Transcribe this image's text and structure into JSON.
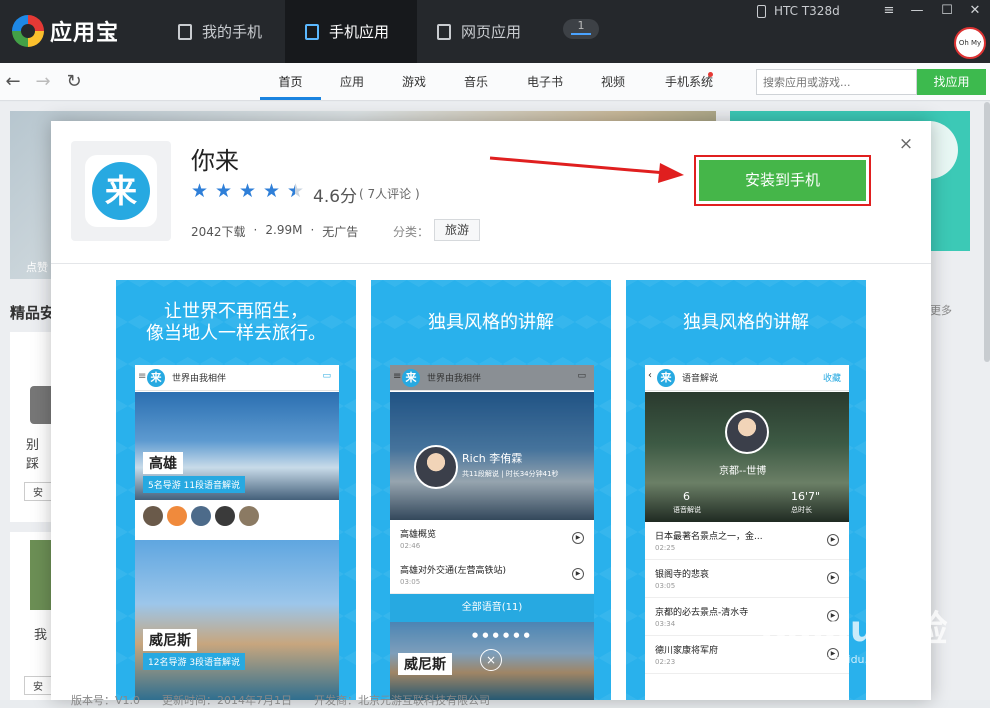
{
  "app": {
    "name": "应用宝"
  },
  "main_tabs": [
    {
      "label": "我的手机",
      "icon": "phone-icon"
    },
    {
      "label": "手机应用",
      "icon": "app-store-icon"
    },
    {
      "label": "网页应用",
      "icon": "web-icon"
    }
  ],
  "badge_count": "1",
  "device": {
    "name": "HTC T328d"
  },
  "window_controls": {
    "menu": "≡",
    "minimize": "—",
    "maximize": "☐",
    "close": "✕"
  },
  "avatar_text": "Oh My Gosh",
  "nav": {
    "categories": [
      "首页",
      "应用",
      "游戏",
      "音乐",
      "电子书",
      "视频",
      "手机系统"
    ],
    "search_placeholder": "搜索应用或游戏...",
    "search_button": "找应用"
  },
  "background": {
    "banner_caption": "点赞",
    "section_title": "精品安",
    "more_label": "更多",
    "card_text_1": "别踩",
    "card_btn_1": "安",
    "card_text_2": "我",
    "card_btn_2": "安"
  },
  "detail": {
    "name": "你来",
    "icon_char": "来",
    "rating": 4.6,
    "score_text": "4.6分",
    "reviews": "( 7人评论 )",
    "downloads": "2042下载",
    "size": "2.99M",
    "ads": "无广告",
    "separator": "·",
    "category_label": "分类：",
    "category": "旅游",
    "install_button": "安装到手机",
    "close": "×",
    "footer": "版本号：V1.0　　更新时间：2014年7月1日　　开发商：北京元游互联科技有限公司"
  },
  "screenshots": [
    {
      "title_line1": "让世界不再陌生，",
      "title_line2": "像当地人一样去旅行。",
      "header": "世界由我相伴",
      "city1": "高雄",
      "city1_sub": "5名导游  11段语音解说",
      "city2": "威尼斯",
      "city2_sub": "12名导游  3段语音解说"
    },
    {
      "title": "独具风格的讲解",
      "header": "世界由我相伴",
      "guide_name": "Rich 李侑霖",
      "guide_info": "共11段解说 | 时长34分钟41秒",
      "items": [
        {
          "title": "高雄概览",
          "time": "02:46"
        },
        {
          "title": "高雄对外交通(左营高铁站)",
          "time": "03:05"
        }
      ],
      "all_voice": "全部语音(11)",
      "city": "威尼斯"
    },
    {
      "title": "独具风格的讲解",
      "header": "语音解说",
      "fav": "收藏",
      "place": "京都--世博",
      "stat1_value": "6",
      "stat1_label": "语音解说",
      "stat2_value": "16'7\"",
      "stat2_label": "总时长",
      "items": [
        {
          "title": "日本最著名景点之一，金...",
          "time": "02:25"
        },
        {
          "title": "银阁寺的悲哀",
          "time": "03:05"
        },
        {
          "title": "京都的必去景点-清水寺",
          "time": "03:34"
        },
        {
          "title": "德川家康将军府",
          "time": "02:23"
        }
      ]
    }
  ],
  "watermark": {
    "main": "Baidu经验",
    "sub": "jingyan.baidu.com"
  },
  "colors": {
    "topbar": "#25282c",
    "accent_blue": "#1a84e0",
    "install_green": "#45b649",
    "highlight_red": "#e01f1f",
    "star_blue": "#2f7fd8"
  }
}
